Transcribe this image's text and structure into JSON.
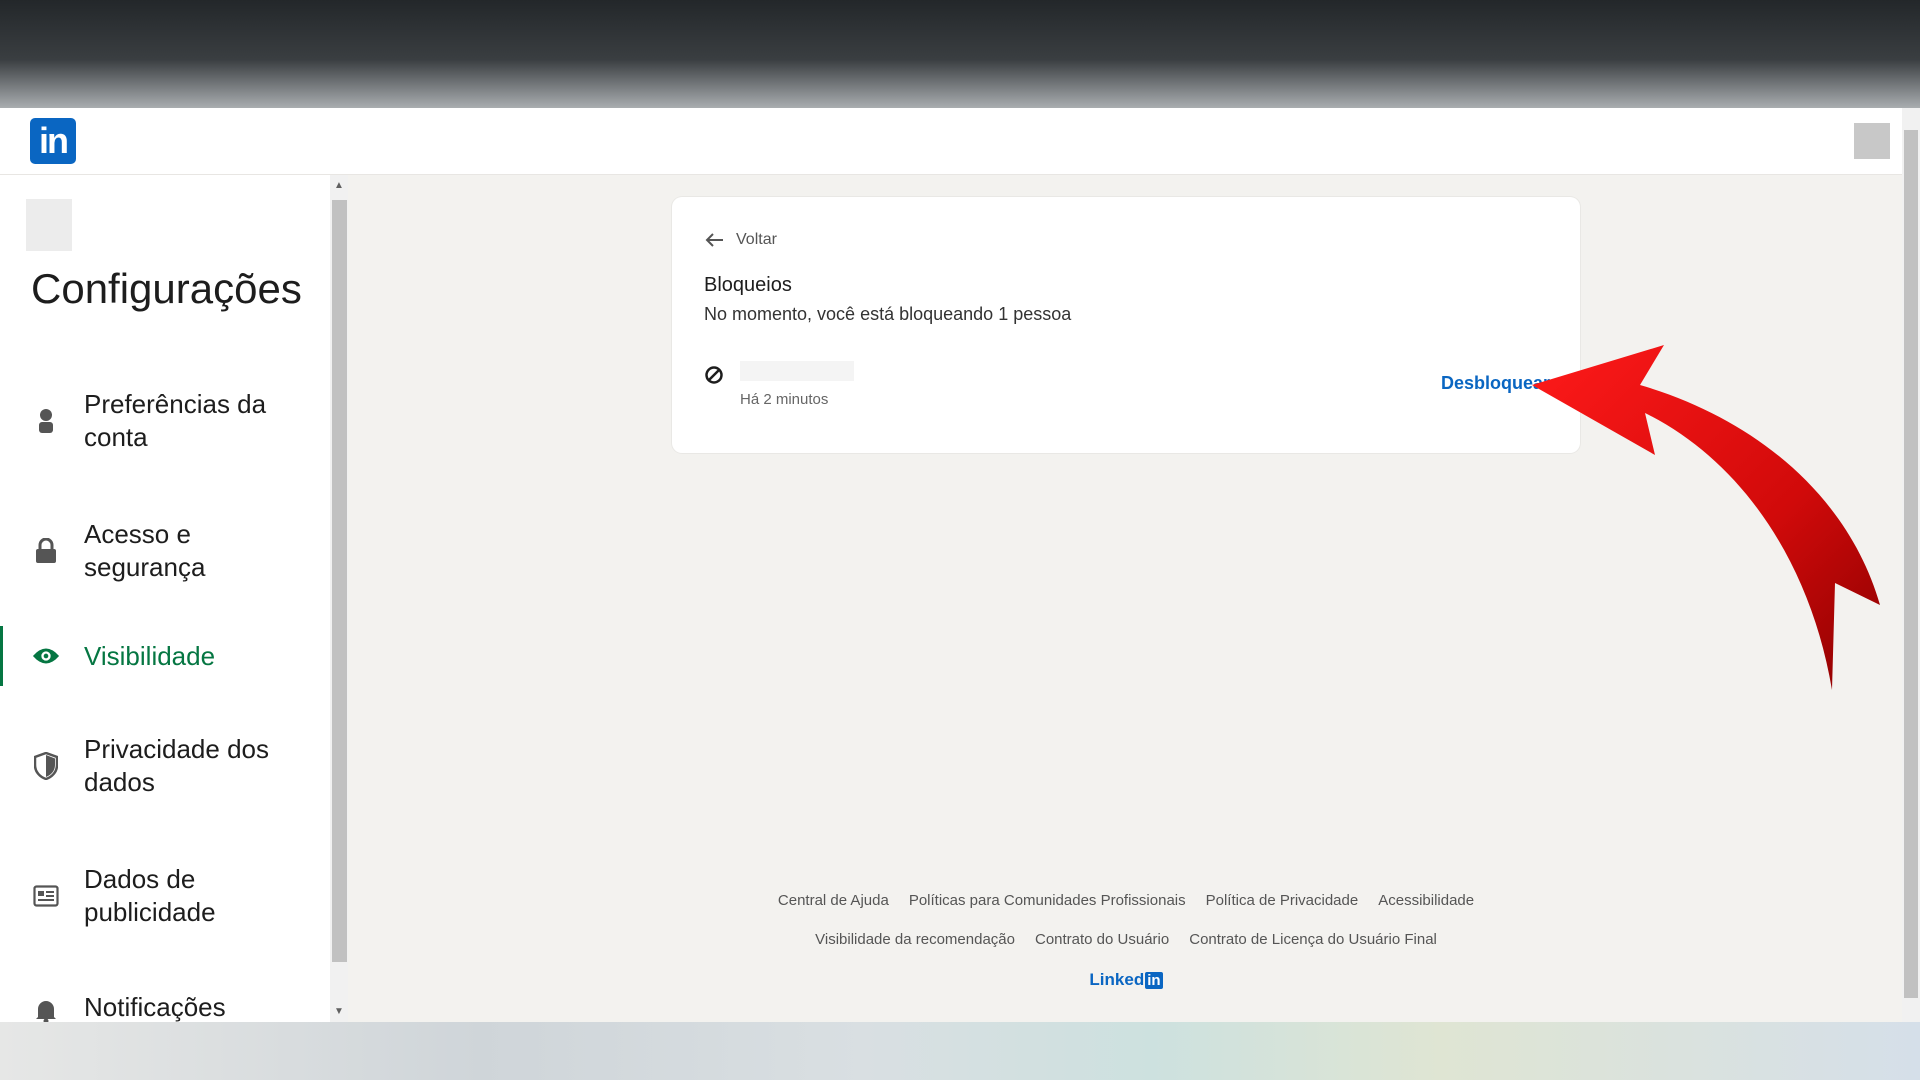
{
  "header": {
    "logo_text": "in"
  },
  "sidebar": {
    "title": "Configurações",
    "items": [
      {
        "label": "Preferências da conta",
        "icon": "person-icon",
        "active": false
      },
      {
        "label": "Acesso e segurança",
        "icon": "lock-icon",
        "active": false
      },
      {
        "label": "Visibilidade",
        "icon": "eye-icon",
        "active": true
      },
      {
        "label": "Privacidade dos dados",
        "icon": "shield-icon",
        "active": false
      },
      {
        "label": "Dados de publicidade",
        "icon": "ad-icon",
        "active": false
      },
      {
        "label": "Notificações",
        "icon": "bell-icon",
        "active": false
      }
    ]
  },
  "card": {
    "back_label": "Voltar",
    "title": "Bloqueios",
    "subtitle": "No momento, você está bloqueando 1 pessoa",
    "blocked": [
      {
        "time": "Há 2 minutos",
        "action": "Desbloquear"
      }
    ]
  },
  "footer": {
    "row1": [
      "Central de Ajuda",
      "Políticas para Comunidades Profissionais",
      "Política de Privacidade",
      "Acessibilidade"
    ],
    "row2": [
      "Visibilidade da recomendação",
      "Contrato do Usuário",
      "Contrato de Licença do Usuário Final"
    ],
    "brand_word": "Linked",
    "brand_in": "in"
  },
  "colors": {
    "brand": "#0a66c2",
    "active": "#057642",
    "annotation_arrow": "#d10a0a"
  }
}
